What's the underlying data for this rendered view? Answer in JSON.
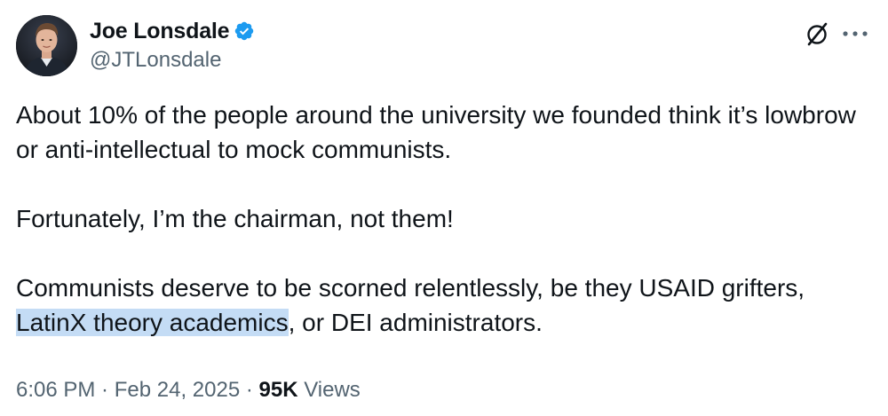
{
  "author": {
    "display_name": "Joe Lonsdale",
    "handle": "@JTLonsdale",
    "verified": true,
    "avatar_icon": "profile-photo"
  },
  "icons": {
    "grok": "grok-icon",
    "more": "more-icon",
    "verified": "verified-badge-icon"
  },
  "colors": {
    "verified_blue": "#1d9bf0",
    "secondary_text": "#536471",
    "primary_text": "#0f1419",
    "selection_highlight": "#c4dcf5"
  },
  "tweet": {
    "para1": "About 10% of the people around the university we founded think it’s lowbrow or anti-intellectual to mock communists.",
    "para2": "Fortunately, I’m the chairman, not them!",
    "para3_before": "Communists deserve to be scorned relentlessly, be they USAID grifters, ",
    "para3_highlight": "LatinX theory academics",
    "para3_after": ", or DEI administrators."
  },
  "meta": {
    "time": "6:06 PM",
    "sep1": " · ",
    "date": "Feb 24, 2025",
    "sep2": " · ",
    "views_count": "95K",
    "views_label": " Views"
  }
}
